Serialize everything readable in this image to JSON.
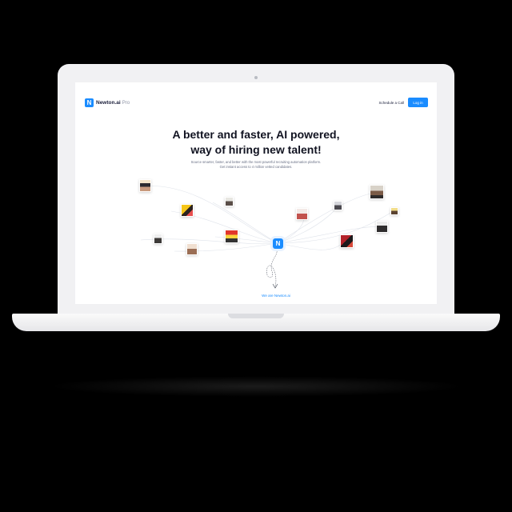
{
  "nav": {
    "logo_mark": "N",
    "logo_name": "Newton.ai",
    "logo_suffix": "Pro",
    "schedule_label": "Schedule a Call",
    "login_label": "Log in"
  },
  "hero": {
    "headline_line1": "A better and faster, AI powered,",
    "headline_line2": "way of hiring new talent!",
    "subtext": "Source smarter, faster, and better with the most powerful recruiting automation platform. Get instant access to 4 million vetted candidates."
  },
  "network": {
    "hub_mark": "N",
    "link_label": "We are Newton.ai"
  },
  "colors": {
    "brand_blue": "#1a8cff",
    "heading": "#111321",
    "body_text": "#6a7186",
    "background": "#ffffff"
  }
}
